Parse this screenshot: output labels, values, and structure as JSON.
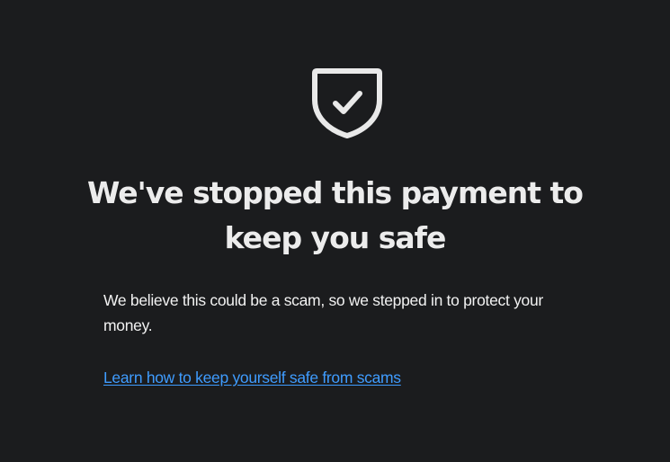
{
  "icon": {
    "name": "shield-check-icon",
    "color": "#e9e9e9"
  },
  "heading": "We've stopped this payment to keep you safe",
  "message": "We believe this could be a scam, so we stepped in to protect your money.",
  "link": {
    "label": "Learn how to keep yourself safe from scams",
    "color": "#3f9cff"
  },
  "colors": {
    "background": "#1b1c1e",
    "text": "#f0f0f0"
  }
}
